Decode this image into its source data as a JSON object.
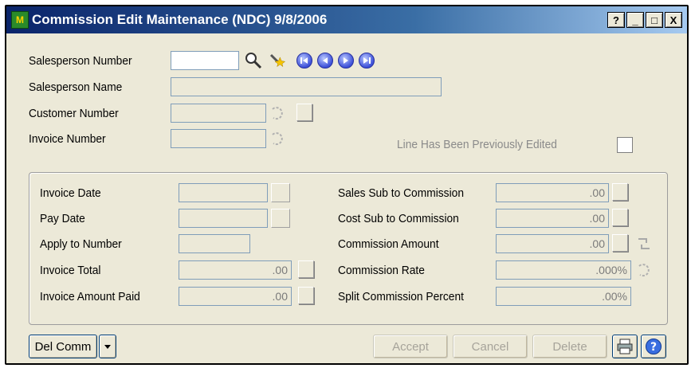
{
  "window": {
    "title": "Commission Edit Maintenance (NDC) 9/8/2006",
    "icon_text": "M",
    "help_btn": "?",
    "min_btn": "_",
    "max_btn": "□",
    "close_btn": "X"
  },
  "header_fields": {
    "salesperson_number_label": "Salesperson Number",
    "salesperson_name_label": "Salesperson Name",
    "customer_number_label": "Customer Number",
    "invoice_number_label": "Invoice Number",
    "line_edited_label": "Line Has Been Previously Edited",
    "salesperson_number_value": "",
    "salesperson_name_value": "",
    "customer_number_value": "",
    "invoice_number_value": ""
  },
  "detail_fields": {
    "invoice_date_label": "Invoice Date",
    "pay_date_label": "Pay Date",
    "apply_to_number_label": "Apply to Number",
    "invoice_total_label": "Invoice Total",
    "invoice_amount_paid_label": "Invoice Amount Paid",
    "invoice_date_value": "",
    "pay_date_value": "",
    "apply_to_number_value": "",
    "invoice_total_value": ".00",
    "invoice_amount_paid_value": ".00",
    "sales_sub_label": "Sales Sub to Commission",
    "cost_sub_label": "Cost Sub to Commission",
    "commission_amount_label": "Commission Amount",
    "commission_rate_label": "Commission Rate",
    "split_commission_label": "Split Commission Percent",
    "sales_sub_value": ".00",
    "cost_sub_value": ".00",
    "commission_amount_value": ".00",
    "commission_rate_value": ".000%",
    "split_commission_value": ".00%"
  },
  "buttons": {
    "del_comm": "Del Comm",
    "accept": "Accept",
    "cancel": "Cancel",
    "delete": "Delete"
  },
  "icons": {
    "lookup": "magnifier-icon",
    "search_wizard": "search-wizard-icon",
    "nav_first": "nav-first-icon",
    "nav_prev": "nav-prev-icon",
    "nav_next": "nav-next-icon",
    "nav_last": "nav-last-icon",
    "print": "printer-icon",
    "help": "help-icon"
  },
  "colors": {
    "title_start": "#0a246a",
    "title_end": "#a6caf0",
    "nav_blue": "#3d50d8",
    "window_bg": "#ece9d8"
  }
}
